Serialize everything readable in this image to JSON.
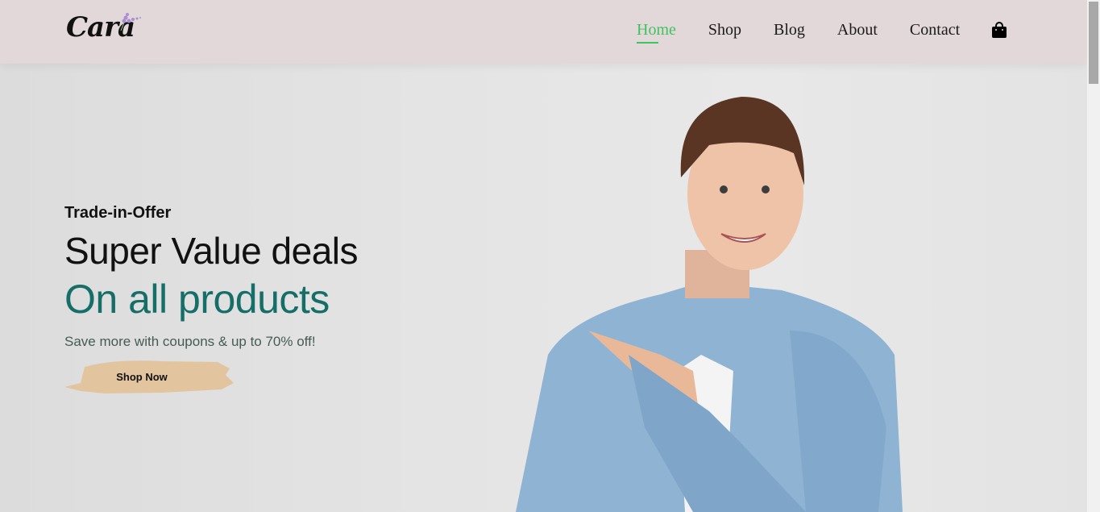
{
  "header": {
    "logo_text": "Cara",
    "nav": [
      {
        "label": "Home",
        "active": true
      },
      {
        "label": "Shop",
        "active": false
      },
      {
        "label": "Blog",
        "active": false
      },
      {
        "label": "About",
        "active": false
      },
      {
        "label": "Contact",
        "active": false
      }
    ],
    "cart_icon": "shopping-bag-icon",
    "accent_color": "#3ec35f"
  },
  "hero": {
    "eyebrow": "Trade-in-Offer",
    "title": "Super Value deals",
    "subtitle": "On all products",
    "subtitle_color": "#166e68",
    "description": "Save more with coupons & up to 70% off!",
    "button_label": "Shop Now",
    "button_color": "#e2c59f"
  }
}
